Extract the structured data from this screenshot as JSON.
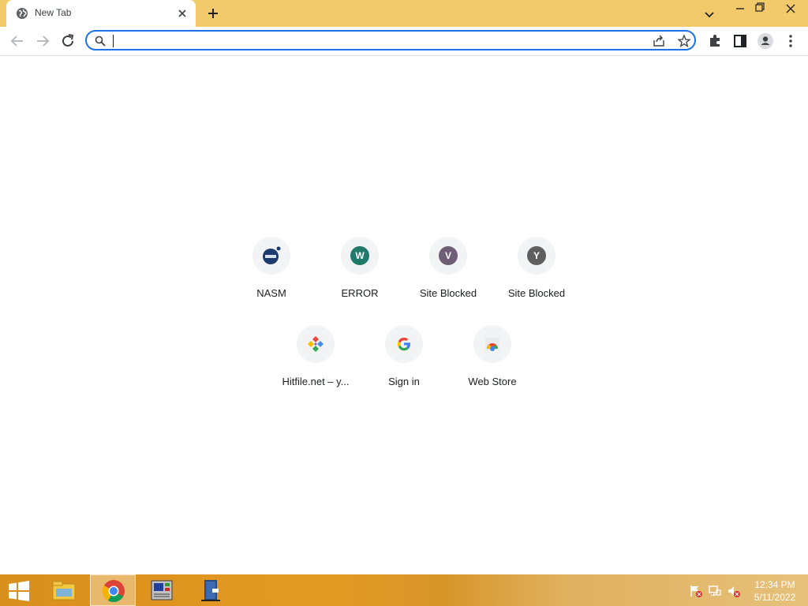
{
  "browser": {
    "tab": {
      "title": "New Tab",
      "favicon": "globe-icon"
    },
    "omnibox": {
      "value": "",
      "placeholder": ""
    }
  },
  "shortcuts": [
    {
      "label": "NASM",
      "icon": "nasm-logo",
      "letter": "",
      "color": "#1d3a6e"
    },
    {
      "label": "ERROR",
      "icon": "letter-w",
      "letter": "W",
      "color": "#1f7a6c"
    },
    {
      "label": "Site Blocked",
      "icon": "letter-v",
      "letter": "V",
      "color": "#6e5f77"
    },
    {
      "label": "Site Blocked",
      "icon": "letter-y",
      "letter": "Y",
      "color": "#5f5f5f"
    },
    {
      "label": "Hitfile.net – y...",
      "icon": "hitfile-logo",
      "letter": "",
      "color": ""
    },
    {
      "label": "Sign in",
      "icon": "google-icon",
      "letter": "",
      "color": ""
    },
    {
      "label": "Web Store",
      "icon": "web-store-icon",
      "letter": "",
      "color": ""
    }
  ],
  "taskbar": {
    "apps": [
      "file-explorer-icon",
      "chrome-icon",
      "system-tool-icon",
      "app-door-icon"
    ],
    "tray": [
      "action-center-flag-icon",
      "network-icon",
      "volume-muted-icon"
    ],
    "clock": {
      "time": "12:34 PM",
      "date": "5/11/2022"
    }
  },
  "colors": {
    "tabstrip": "#f2c96b",
    "accent": "#1a73e8",
    "taskbar": "#e39a22"
  }
}
